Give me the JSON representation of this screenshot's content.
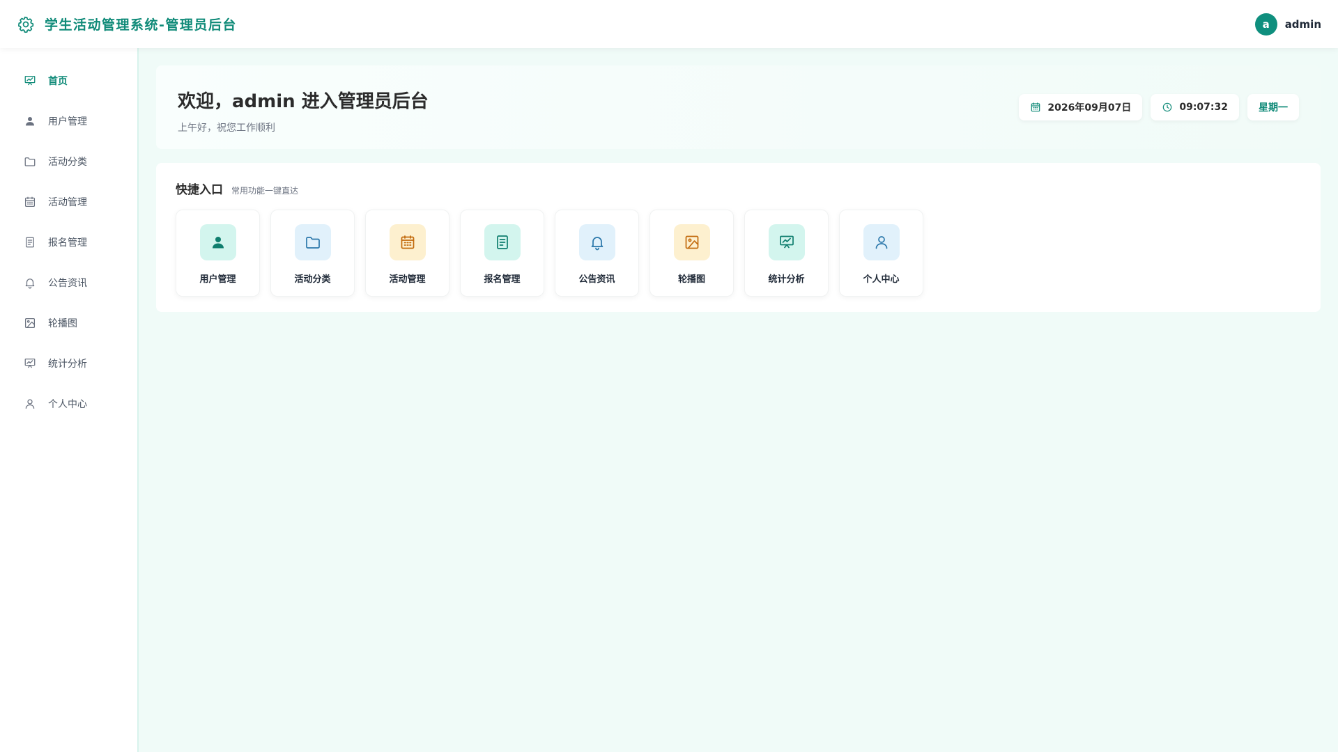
{
  "app": {
    "title": "学生活动管理系统-管理员后台"
  },
  "user": {
    "avatar_letter": "a",
    "name": "admin"
  },
  "sidebar": {
    "items": [
      {
        "label": "首页",
        "icon": "presentation-chart-icon",
        "active": true
      },
      {
        "label": "用户管理",
        "icon": "user-icon"
      },
      {
        "label": "活动分类",
        "icon": "folder-icon"
      },
      {
        "label": "活动管理",
        "icon": "calendar-icon"
      },
      {
        "label": "报名管理",
        "icon": "document-icon"
      },
      {
        "label": "公告资讯",
        "icon": "bell-icon"
      },
      {
        "label": "轮播图",
        "icon": "image-icon"
      },
      {
        "label": "统计分析",
        "icon": "presentation-chart-icon"
      },
      {
        "label": "个人中心",
        "icon": "user-outline-icon"
      }
    ]
  },
  "welcome": {
    "title": "欢迎，admin 进入管理员后台",
    "subtitle": "上午好，祝您工作顺利",
    "date": "2026年09月07日",
    "time": "09:07:32",
    "weekday": "星期一"
  },
  "quick": {
    "title": "快捷入口",
    "subtitle": "常用功能一键直达",
    "items": [
      {
        "label": "用户管理",
        "icon": "user-icon",
        "bg": "#d3f5ee",
        "fg": "#0f7e6e"
      },
      {
        "label": "活动分类",
        "icon": "folder-icon",
        "bg": "#e1f1fb",
        "fg": "#2a77aa"
      },
      {
        "label": "活动管理",
        "icon": "calendar-icon",
        "bg": "#fdf0cf",
        "fg": "#c26a0c"
      },
      {
        "label": "报名管理",
        "icon": "document-icon",
        "bg": "#d3f5ee",
        "fg": "#0f7e6e"
      },
      {
        "label": "公告资讯",
        "icon": "bell-icon",
        "bg": "#e1f1fb",
        "fg": "#2a77aa"
      },
      {
        "label": "轮播图",
        "icon": "image-icon",
        "bg": "#fdf0cf",
        "fg": "#c26a0c"
      },
      {
        "label": "统计分析",
        "icon": "presentation-chart-icon",
        "bg": "#d3f5ee",
        "fg": "#0f7e6e"
      },
      {
        "label": "个人中心",
        "icon": "user-outline-icon",
        "bg": "#e1f1fb",
        "fg": "#2a77aa"
      }
    ]
  },
  "colors": {
    "accent": "#0f8a78",
    "page_bg": "#f0fbf8"
  }
}
